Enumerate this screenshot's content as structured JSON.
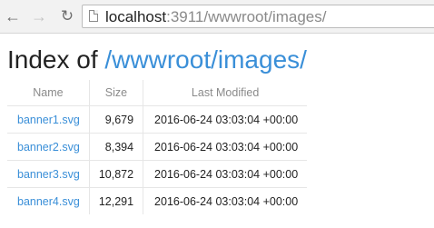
{
  "browser": {
    "url_host": "localhost",
    "url_rest": ":3911/wwwroot/images/"
  },
  "page": {
    "title_prefix": "Index of ",
    "title_path": "/wwwroot/images/"
  },
  "table": {
    "headers": {
      "name": "Name",
      "size": "Size",
      "modified": "Last Modified"
    },
    "rows": [
      {
        "name": "banner1.svg",
        "size": "9,679",
        "modified": "2016-06-24 03:03:04 +00:00"
      },
      {
        "name": "banner2.svg",
        "size": "8,394",
        "modified": "2016-06-24 03:03:04 +00:00"
      },
      {
        "name": "banner3.svg",
        "size": "10,872",
        "modified": "2016-06-24 03:03:04 +00:00"
      },
      {
        "name": "banner4.svg",
        "size": "12,291",
        "modified": "2016-06-24 03:03:04 +00:00"
      }
    ]
  }
}
